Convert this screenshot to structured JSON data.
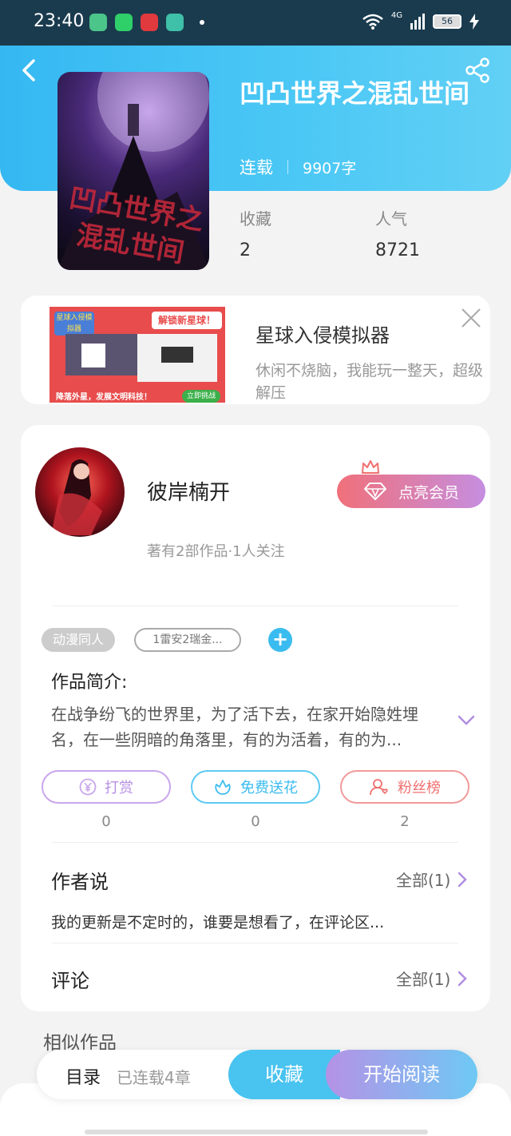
{
  "status_bar": {
    "time": "23:40",
    "network": "4G",
    "battery": "56",
    "icons": [
      "app-green-icon",
      "app-play-icon",
      "app-red-icon",
      "app-teal-icon",
      "wifi-icon",
      "signal-icon",
      "battery-icon",
      "charging-icon"
    ]
  },
  "book": {
    "title": "凹凸世界之混乱世间",
    "cover_text": "凹凸世界之混乱世间",
    "status": "连载",
    "word_count": "9907字",
    "stats": [
      {
        "label": "收藏",
        "value": "2"
      },
      {
        "label": "人气",
        "value": "8721"
      }
    ]
  },
  "ad": {
    "title": "星球入侵模拟器",
    "description": "休闲不烧脑，我能玩一整天，超级解压",
    "image_texts": [
      "星球入侵模拟器",
      "解锁新星球！",
      "降落外星，发展文明科技！",
      "立即挑战"
    ]
  },
  "author": {
    "name": "彼岸楠开",
    "works": "著有2部作品·1人关注",
    "vip_label": "点亮会员"
  },
  "tags": [
    "动漫同人",
    "1雷安2瑞金..."
  ],
  "intro": {
    "label": "作品简介:",
    "text": "在战争纷飞的世界里，为了活下去，在家开始隐姓埋名，在一些阴暗的角落里，有的为活着，有的为..."
  },
  "actions": [
    {
      "label": "打赏",
      "count": "0",
      "icon": "yen-icon",
      "color": "#c18ee6"
    },
    {
      "label": "免费送花",
      "count": "0",
      "icon": "flower-icon",
      "color": "#3bbcf0"
    },
    {
      "label": "粉丝榜",
      "count": "2",
      "icon": "fans-icon",
      "color": "#f07070"
    }
  ],
  "author_says": {
    "title": "作者说",
    "all": "全部(1)",
    "text": "我的更新是不定时的，谁要是想看了，在评论区..."
  },
  "comments": {
    "title": "评论",
    "all": "全部(1)"
  },
  "similar": {
    "title": "相似作品"
  },
  "bottom_bar": {
    "toc": "目录",
    "serial": "已连载4章",
    "favorite": "收藏",
    "read": "开始阅读"
  }
}
